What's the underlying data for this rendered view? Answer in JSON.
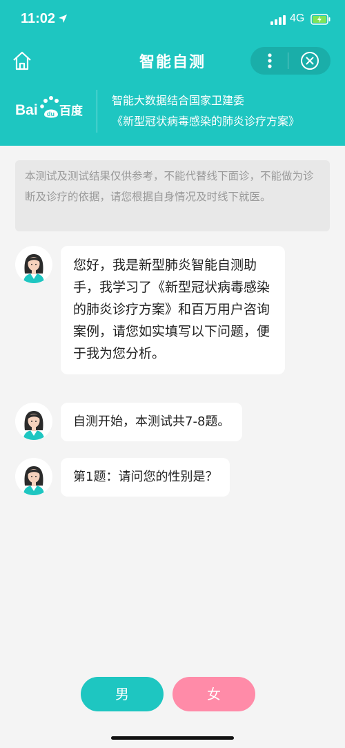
{
  "status_bar": {
    "time": "11:02",
    "network": "4G"
  },
  "nav": {
    "title": "智能自测"
  },
  "brand": {
    "logo_text": "Bai百度",
    "line1": "智能大数据结合国家卫建委",
    "line2": "《新型冠状病毒感染的肺炎诊疗方案》"
  },
  "notice": "本测试及测试结果仅供参考，不能代替线下面诊，不能做为诊断及诊疗的依据，请您根据自身情况及时线下就医。",
  "messages": [
    "您好，我是新型肺炎智能自测助手，我学习了《新型冠状病毒感染的肺炎诊疗方案》和百万用户咨询案例，请您如实填写以下问题，便于我为您分析。",
    "自测开始，本测试共7-8题。",
    "第1题：请问您的性别是？"
  ],
  "answers": {
    "male": "男",
    "female": "女"
  },
  "colors": {
    "primary": "#1ec6c1",
    "female_button": "#ff8ba8",
    "background": "#f4f4f4"
  },
  "icons": [
    "location-arrow-icon",
    "signal-icon",
    "battery-charging-icon",
    "home-icon",
    "more-dots-icon",
    "close-circle-icon",
    "baidu-logo",
    "doctor-avatar"
  ]
}
